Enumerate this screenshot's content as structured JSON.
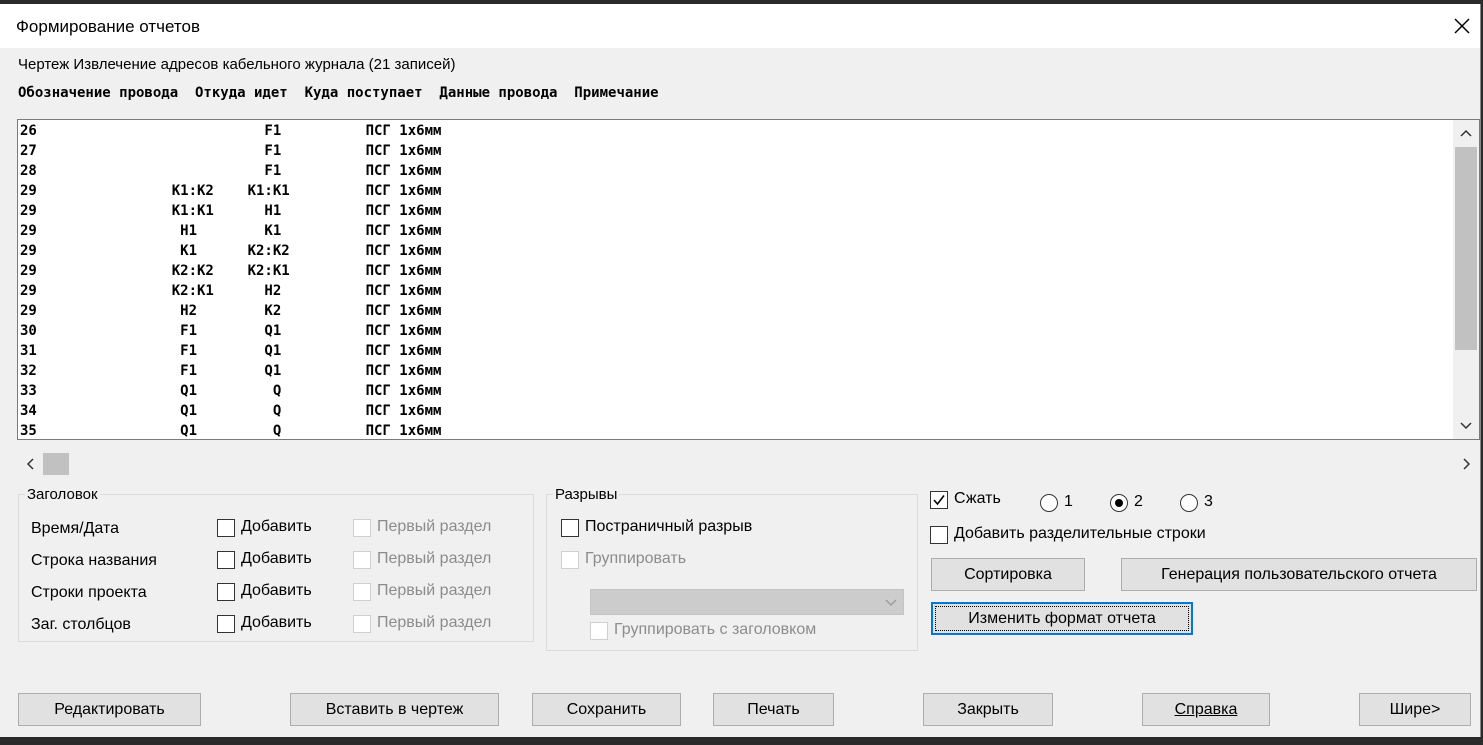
{
  "window": {
    "title": "Формирование отчетов"
  },
  "info": "Чертеж Извлечение адресов кабельного журнала (21 записей)",
  "columns_header": "Обозначение провода  Откуда идет  Куда поступает  Данные провода  Примечание",
  "rows": [
    "26                           F1          ПСГ 1х6мм",
    "27                           F1          ПСГ 1х6мм",
    "28                           F1          ПСГ 1х6мм",
    "29                K1:K2    K1:K1         ПСГ 1х6мм",
    "29                K1:K1      H1          ПСГ 1х6мм",
    "29                 H1        K1          ПСГ 1х6мм",
    "29                 K1      K2:K2         ПСГ 1х6мм",
    "29                K2:K2    K2:K1         ПСГ 1х6мм",
    "29                K2:K1      H2          ПСГ 1х6мм",
    "29                 H2        K2          ПСГ 1х6мм",
    "30                 F1        Q1          ПСГ 1х6мм",
    "31                 F1        Q1          ПСГ 1х6мм",
    "32                 F1        Q1          ПСГ 1х6мм",
    "33                 Q1         Q          ПСГ 1х6мм",
    "34                 Q1         Q          ПСГ 1х6мм",
    "35                 Q1         Q          ПСГ 1х6мм"
  ],
  "header_group": {
    "legend": "Заголовок",
    "rows": [
      {
        "label": "Время/Дата",
        "add": "Добавить",
        "first": "Первый раздел"
      },
      {
        "label": "Строка названия",
        "add": "Добавить",
        "first": "Первый раздел"
      },
      {
        "label": "Строки проекта",
        "add": "Добавить",
        "first": "Первый раздел"
      },
      {
        "label": "Заг. столбцов",
        "add": "Добавить",
        "first": "Первый раздел"
      }
    ]
  },
  "breaks_group": {
    "legend": "Разрывы",
    "page_break": "Постраничный разрыв",
    "group": "Группировать",
    "group_with_header": "Группировать с заголовком"
  },
  "options": {
    "compress": "Сжать",
    "radio1": "1",
    "radio2": "2",
    "radio3": "3",
    "add_separator": "Добавить разделительные строки"
  },
  "buttons": {
    "sort": "Сортировка",
    "custom_report": "Генерация пользовательского отчета",
    "change_format": "Изменить формат отчета",
    "edit": "Редактировать",
    "insert": "Вставить в чертеж",
    "save": "Сохранить",
    "print": "Печать",
    "close": "Закрыть",
    "help": "Справка",
    "wider": "Шире>"
  }
}
